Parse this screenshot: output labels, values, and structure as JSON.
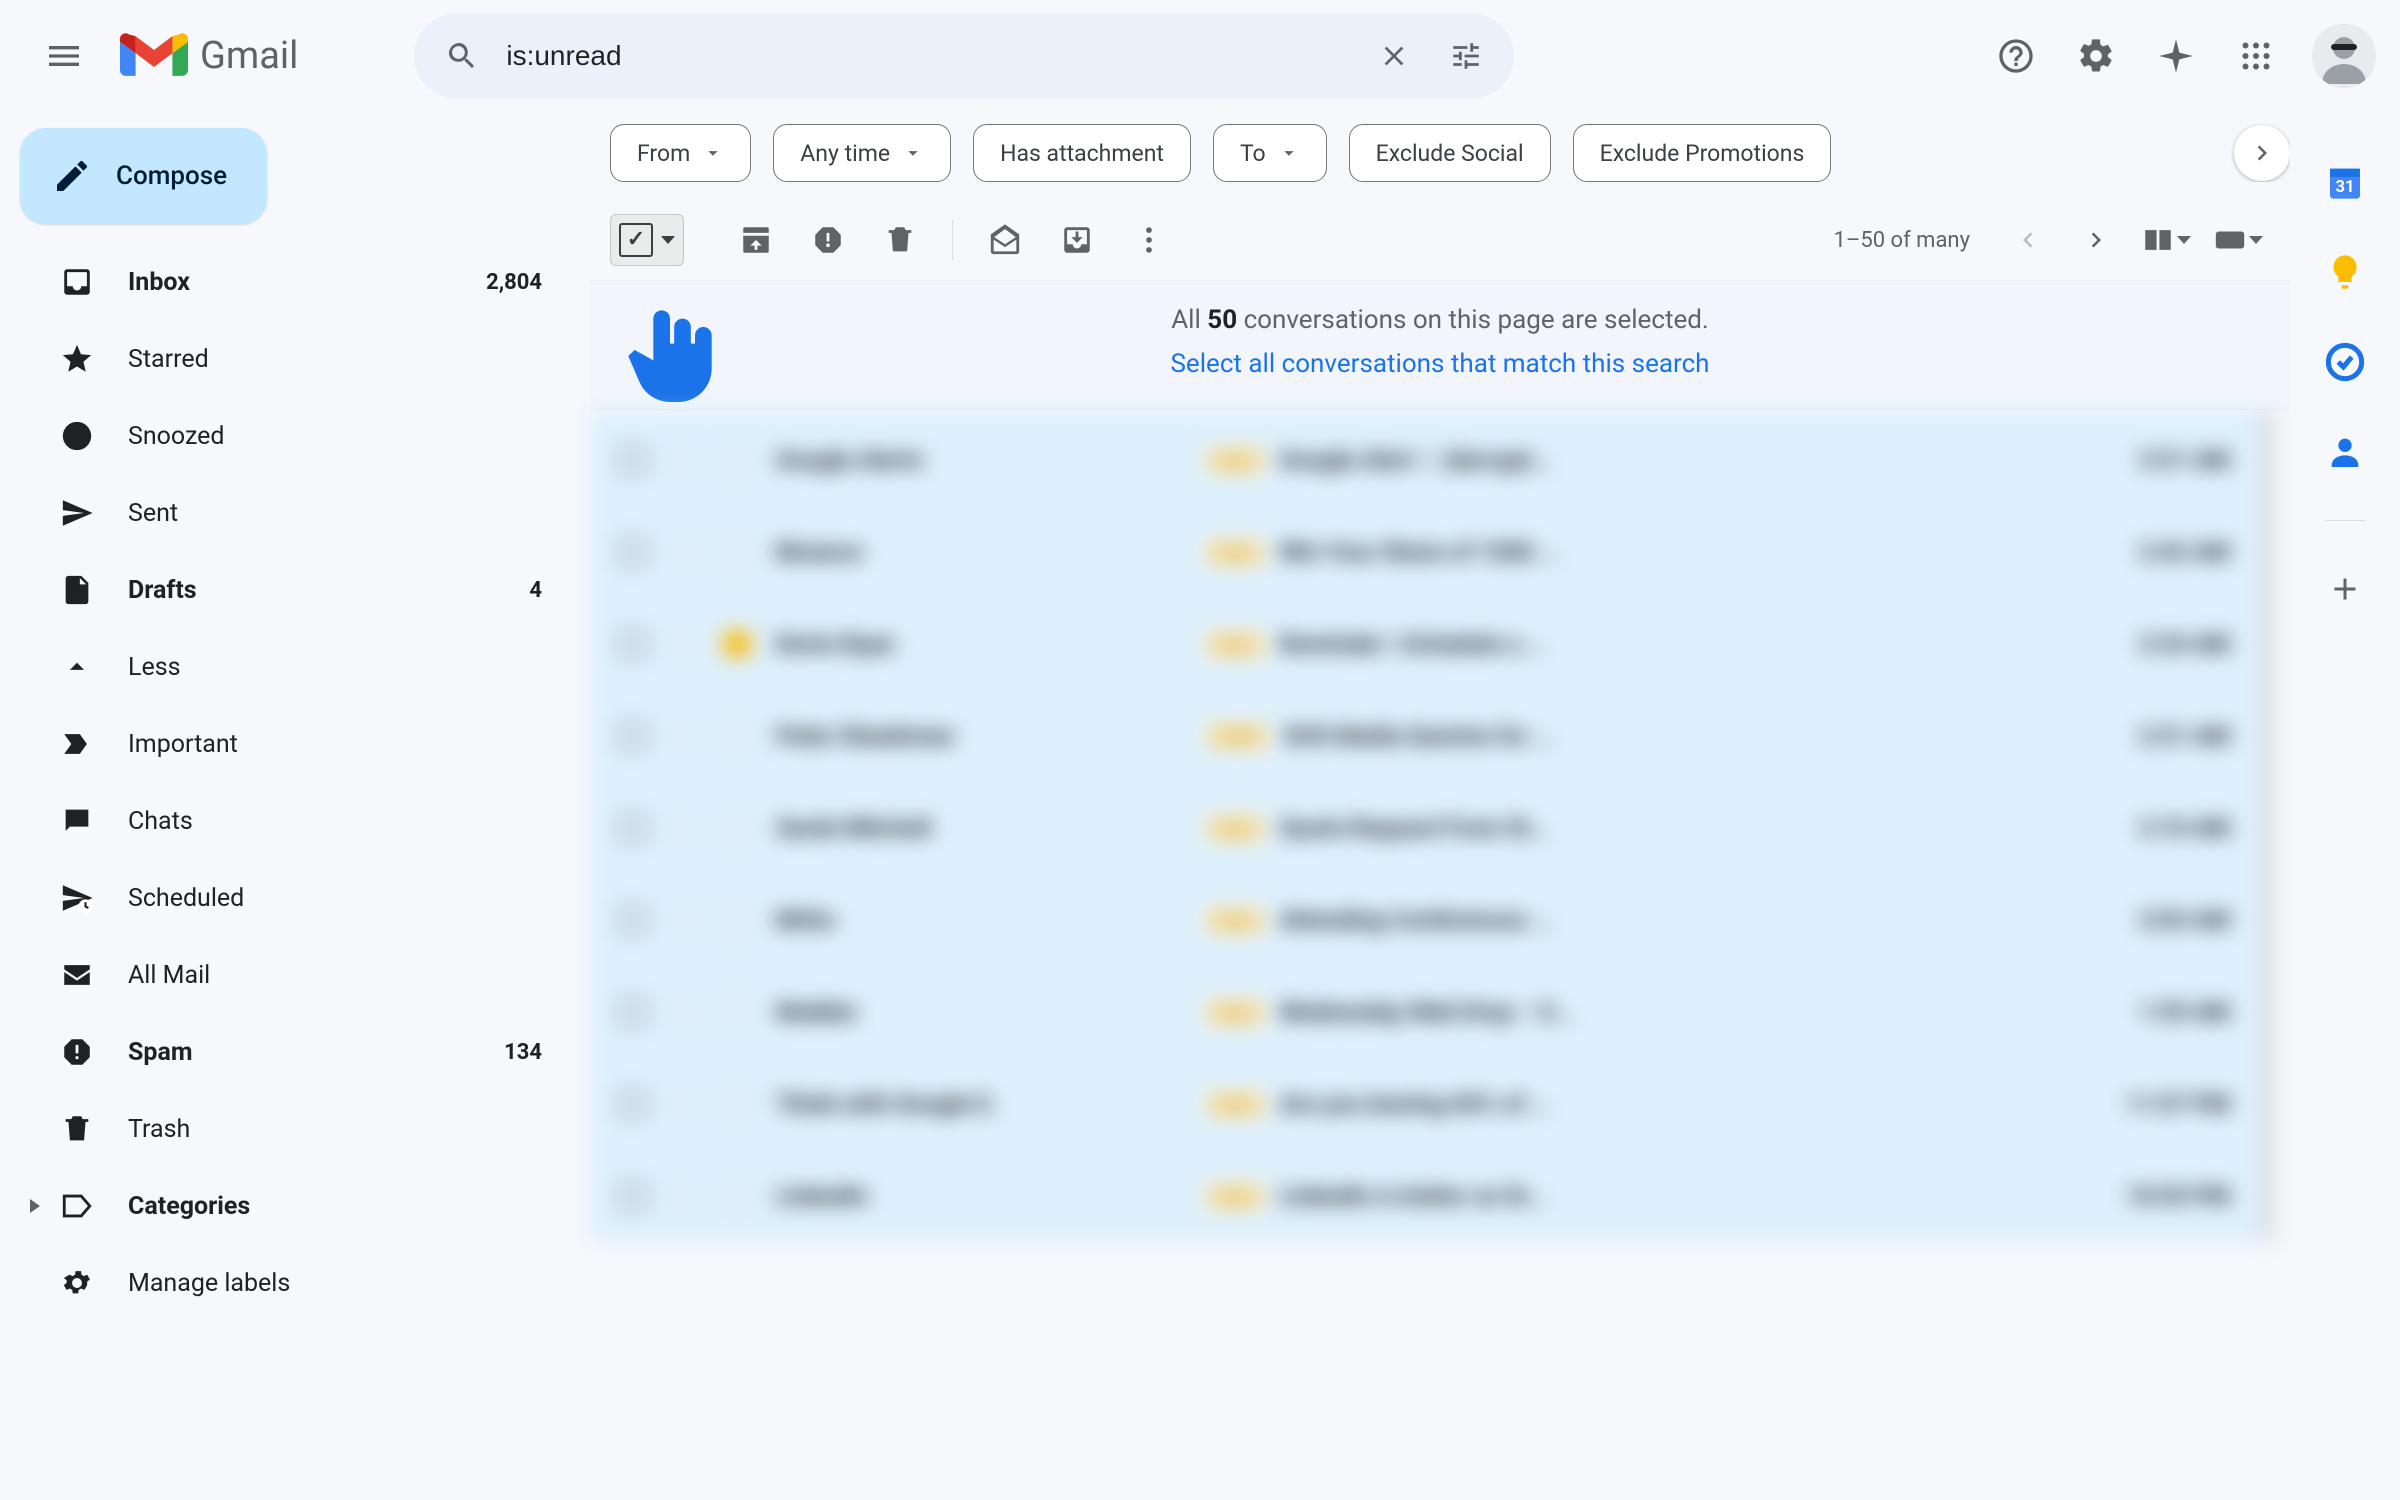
{
  "header": {
    "app_name": "Gmail",
    "search_value": "is:unread"
  },
  "compose_label": "Compose",
  "sidebar": {
    "items": [
      {
        "key": "inbox",
        "label": "Inbox",
        "count": "2,804",
        "bold": true
      },
      {
        "key": "starred",
        "label": "Starred"
      },
      {
        "key": "snoozed",
        "label": "Snoozed"
      },
      {
        "key": "sent",
        "label": "Sent"
      },
      {
        "key": "drafts",
        "label": "Drafts",
        "count": "4",
        "bold": true
      },
      {
        "key": "less",
        "label": "Less"
      },
      {
        "key": "important",
        "label": "Important"
      },
      {
        "key": "chats",
        "label": "Chats"
      },
      {
        "key": "scheduled",
        "label": "Scheduled"
      },
      {
        "key": "allmail",
        "label": "All Mail"
      },
      {
        "key": "spam",
        "label": "Spam",
        "count": "134",
        "bold": true
      },
      {
        "key": "trash",
        "label": "Trash"
      },
      {
        "key": "categories",
        "label": "Categories",
        "bold": true
      },
      {
        "key": "manage",
        "label": "Manage labels"
      }
    ]
  },
  "chips": [
    {
      "label": "From",
      "dropdown": true
    },
    {
      "label": "Any time",
      "dropdown": true
    },
    {
      "label": "Has attachment",
      "dropdown": false
    },
    {
      "label": "To",
      "dropdown": true
    },
    {
      "label": "Exclude Social",
      "dropdown": false
    },
    {
      "label": "Exclude Promotions",
      "dropdown": false
    }
  ],
  "action_row": {
    "page_count": "1–50 of many"
  },
  "banner": {
    "prefix": "All ",
    "count": "50",
    "suffix": " conversations on this page are selected.",
    "link": "Select all conversations that match this search"
  },
  "emails": [
    {
      "sender": "Google Alerts",
      "subject": "Google Alert – (decrypt…",
      "time": "3:31 AM",
      "label": "Inbox"
    },
    {
      "sender": "Binance",
      "subject": "Win Your Share of 1000 …",
      "time": "2:42 AM",
      "label": "Inbox"
    },
    {
      "sender": "Kevin Ryan",
      "subject": "Reminder | Schedule a …",
      "time": "2:34 AM",
      "label": "Inbox",
      "important": true
    },
    {
      "sender": "Peter Shankman",
      "subject": "SOS Media Queries for …",
      "time": "2:31 AM",
      "label": "HARO"
    },
    {
      "sender": "Sarah Mitchell",
      "subject": "Quote Request From St…",
      "time": "2:10 AM",
      "label": "Inbox"
    },
    {
      "sender": "BitGo",
      "subject": "Attending Conferences …",
      "time": "2:03 AM",
      "label": "Inbox"
    },
    {
      "sender": "Mobbin",
      "subject": "Wednesday Web Drop – E…",
      "time": "1:39 AM",
      "label": "Inbox"
    },
    {
      "sender": "Think with Google E.",
      "subject": "Are you leaving 60% of …",
      "time": "11:57 PM",
      "label": "Inbox"
    },
    {
      "sender": "LinkedIn",
      "subject": "LinkedIn is better on th…",
      "time": "10:55 PM",
      "label": "Inbox"
    }
  ]
}
